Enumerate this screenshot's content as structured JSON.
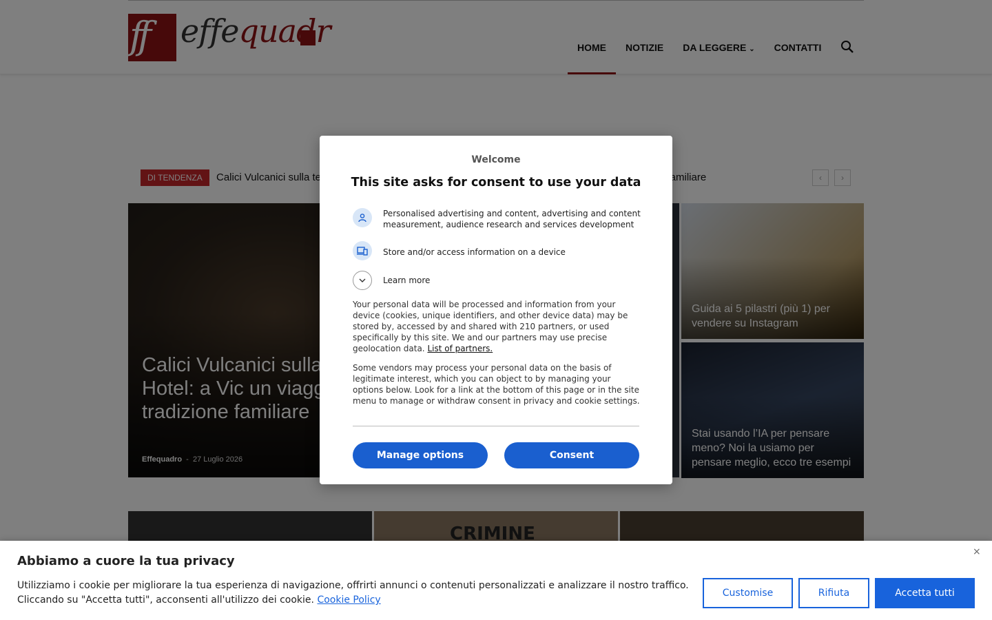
{
  "header": {
    "logo_box": "ff",
    "logo_text_a": "effe",
    "logo_text_b": "quadr",
    "nav": [
      "HOME",
      "NOTIZIE",
      "DA LEGGERE",
      "CONTATTI"
    ]
  },
  "ticker": {
    "badge": "DI TENDENZA",
    "text": "Calici Vulcanici sulla te",
    "text_tail": "e familiare"
  },
  "articles": {
    "main_title": "Calici Vulcanici sulla t dell’Aequa Hotel: a Vic un viaggio tra vini, cuc tradizione familiare",
    "main_author": "Effequadro",
    "main_date": "27 Luglio 2026",
    "side1_title": "Guida ai 5 pilastri (più 1) per vendere su Instagram",
    "side2_title": "Stai usando l’IA per pensare meno? Noi la usiamo per pensare meglio, ecco tre esempi",
    "bottom2_text": "CRIMINE"
  },
  "consent_modal": {
    "welcome": "Welcome",
    "title": "This site asks for consent to use your data",
    "purpose1": "Personalised advertising and content, advertising and content measurement, audience research and services development",
    "purpose2": "Store and/or access information on a device",
    "learn_more": "Learn more",
    "para1": "Your personal data will be processed and information from your device (cookies, unique identifiers, and other device data) may be stored by, accessed by and shared with 210 partners, or used specifically by this site. We and our partners may use precise geolocation data.",
    "partners_link": "List of partners.",
    "para2": "Some vendors may process your personal data on the basis of legitimate interest, which you can object to by managing your options below. Look for a link at the bottom of this page or in the site menu to manage or withdraw consent in privacy and cookie settings.",
    "manage_btn": "Manage options",
    "consent_btn": "Consent"
  },
  "cookie_bar": {
    "title": "Abbiamo a cuore la tua privacy",
    "text": "Utilizziamo i cookie per migliorare la tua esperienza di navigazione, offrirti annunci o contenuti personalizzati e analizzare il nostro traffico. Cliccando su \"Accetta tutti\", acconsenti all'utilizzo dei cookie.",
    "policy_link": "Cookie Policy",
    "close": "×",
    "customise": "Customise",
    "reject": "Rifiuta",
    "accept": "Accetta tutti"
  },
  "colors": {
    "brand_red": "#8e1214",
    "consent_blue": "#1a5fcf",
    "cookie_blue": "#1863dc"
  },
  "icons": [
    "search-icon",
    "chevron-down-icon",
    "person-icon",
    "devices-icon",
    "chevron-left-icon",
    "chevron-right-icon",
    "close-icon"
  ]
}
